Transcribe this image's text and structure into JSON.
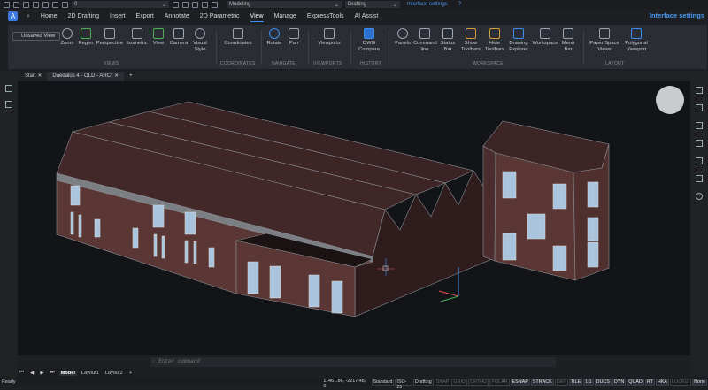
{
  "quick_access": {
    "layer_value": "0",
    "workspace": "Modeling",
    "profile": "Drafting",
    "interface_settings": "Interface settings",
    "help": "?"
  },
  "menu": {
    "tabs": [
      "Home",
      "2D Drafting",
      "Insert",
      "Export",
      "Annotate",
      "2D Parametric",
      "View",
      "Manage",
      "ExpressTools",
      "AI Assist"
    ],
    "active": "View",
    "interface_settings": "Interface settings"
  },
  "ribbon": {
    "unsaved_view": "Unsaved View",
    "buttons": [
      {
        "label": "Zoom",
        "group": "VIEWS"
      },
      {
        "label": "Regen"
      },
      {
        "label": "Perspective"
      },
      {
        "label": "Isometric"
      },
      {
        "label": "View"
      },
      {
        "label": "Camera"
      },
      {
        "label": "Visual Style"
      },
      {
        "label": "Coordinates"
      },
      {
        "label": "Rotate"
      },
      {
        "label": "Pan"
      },
      {
        "label": "Viewports"
      },
      {
        "label": "DWG Compare"
      },
      {
        "label": "Panels"
      },
      {
        "label": "Command line"
      },
      {
        "label": "Status Bar"
      },
      {
        "label": "Show Toolbars"
      },
      {
        "label": "Hide Toolbars"
      },
      {
        "label": "Drawing Explorer"
      },
      {
        "label": "Workspace"
      },
      {
        "label": "Menu Bar"
      },
      {
        "label": "Paper Space Views"
      },
      {
        "label": "Polygonal Viewport"
      }
    ],
    "groups": [
      "VIEWS",
      "COORDINATES",
      "NAVIGATE",
      "VIEWPORTS",
      "HISTORY",
      "WORKSPACE",
      "LAYOUT"
    ]
  },
  "doc_tabs": [
    "Start",
    "Daedalus 4 - OLD - ARC*"
  ],
  "command": {
    "placeholder": ": Enter command"
  },
  "layout_tabs": [
    "Model",
    "Layout1",
    "Layout2"
  ],
  "status": {
    "ready": "Ready",
    "coords": "11461.86, -2217.48, 0",
    "items": [
      "Standard",
      "ISO-25",
      "Drafting",
      "SNAP",
      "GRID",
      "ORTHO",
      "POLAR",
      "ESNAP",
      "STRACK",
      "LWT",
      "TILE",
      "1:1",
      "DUCS",
      "DYN",
      "QUAD",
      "RT",
      "HKA",
      "LOCKUI",
      "None"
    ],
    "off": [
      "SNAP",
      "GRID",
      "ORTHO",
      "POLAR",
      "LWT",
      "LOCKUI"
    ]
  },
  "colors": {
    "accent": "#3c8ef0",
    "brick": "#5a3634",
    "roof": "#3d2526"
  }
}
